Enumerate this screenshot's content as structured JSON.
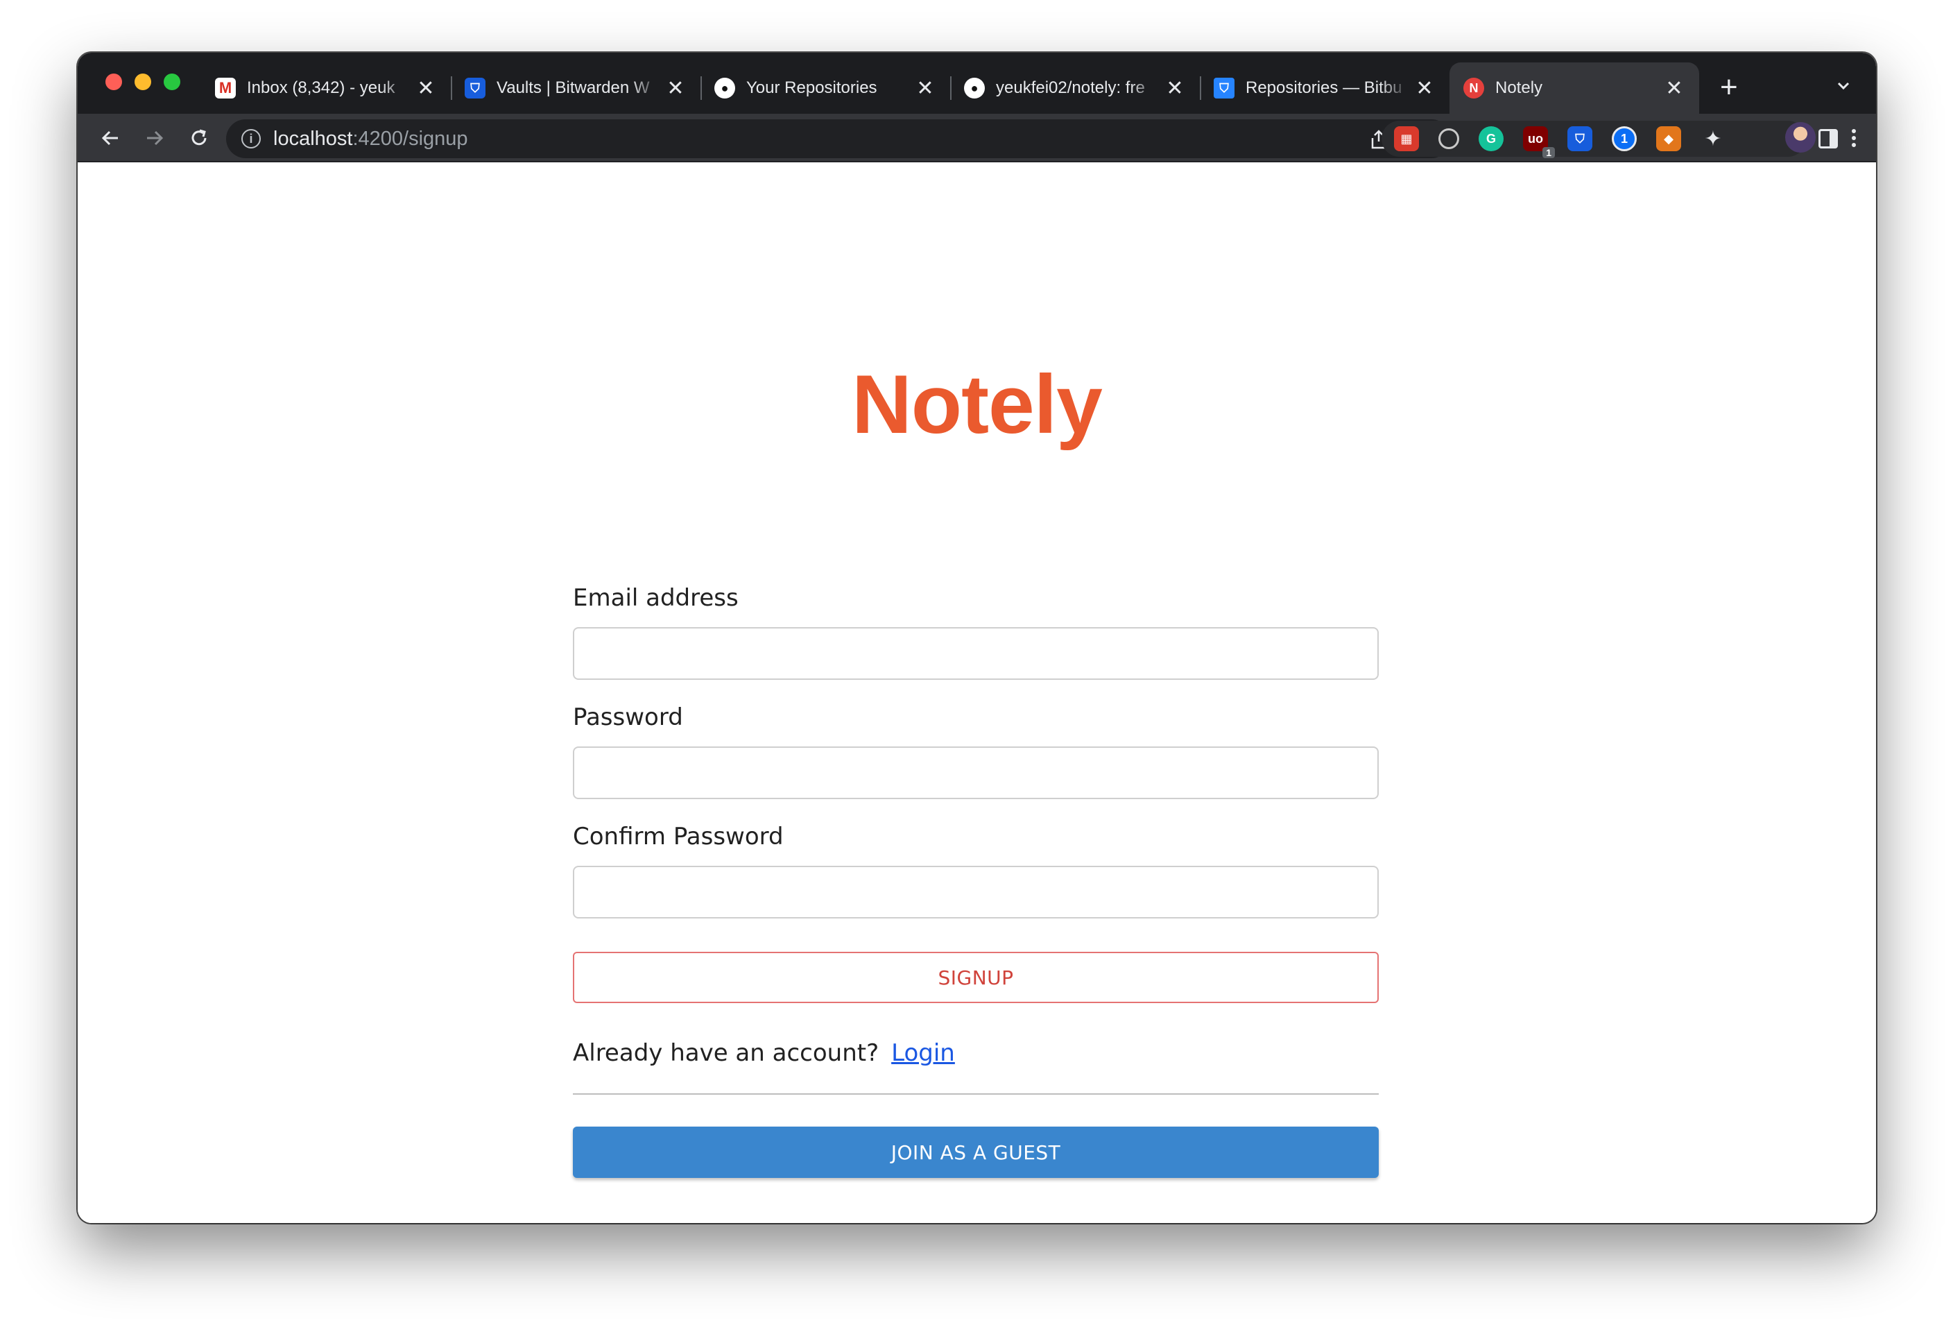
{
  "browser": {
    "tabs": [
      {
        "title": "Inbox (8,342) - yeuk",
        "favicon": "gmail-icon"
      },
      {
        "title": "Vaults | Bitwarden W",
        "favicon": "bitwarden-icon"
      },
      {
        "title": "Your Repositories",
        "favicon": "github-icon"
      },
      {
        "title": "yeukfei02/notely: fre",
        "favicon": "github-icon"
      },
      {
        "title": "Repositories — Bitbu",
        "favicon": "bitbucket-icon"
      },
      {
        "title": "Notely",
        "favicon": "notely-icon",
        "active": true
      }
    ],
    "fav_glyphs": {
      "gmail": "M",
      "bitwarden": "⛉",
      "github": "●",
      "bitbucket": "⛉",
      "notely": "N"
    },
    "close_glyph": "✕",
    "new_tab_glyph": "+",
    "url_host": "localhost",
    "url_path": ":4200/signup",
    "info_glyph": "i",
    "extensions": [
      {
        "name": "extension-1-icon",
        "glyph": "▦"
      },
      {
        "name": "extension-2-icon",
        "glyph": ""
      },
      {
        "name": "grammarly-icon",
        "glyph": "G"
      },
      {
        "name": "ublock-icon",
        "glyph": "uo",
        "badge": "1"
      },
      {
        "name": "bitwarden-extension-icon",
        "glyph": "⛉"
      },
      {
        "name": "onepassword-icon",
        "glyph": "1"
      },
      {
        "name": "metamask-icon",
        "glyph": "◆"
      },
      {
        "name": "extensions-puzzle-icon",
        "glyph": "✦"
      }
    ]
  },
  "app": {
    "brand": "Notely",
    "brand_color": "#ea5a2e",
    "form": {
      "email_label": "Email address",
      "email_value": "",
      "password_label": "Password",
      "password_value": "",
      "confirm_label": "Confirm Password",
      "confirm_value": "",
      "signup_button": "SIGNUP",
      "have_account_text": "Already have an account?",
      "login_link": "Login",
      "guest_button": "JOIN AS A GUEST"
    },
    "colors": {
      "signup_border": "#e57373",
      "guest_button": "#3a86ce",
      "link": "#1a57e2"
    }
  }
}
